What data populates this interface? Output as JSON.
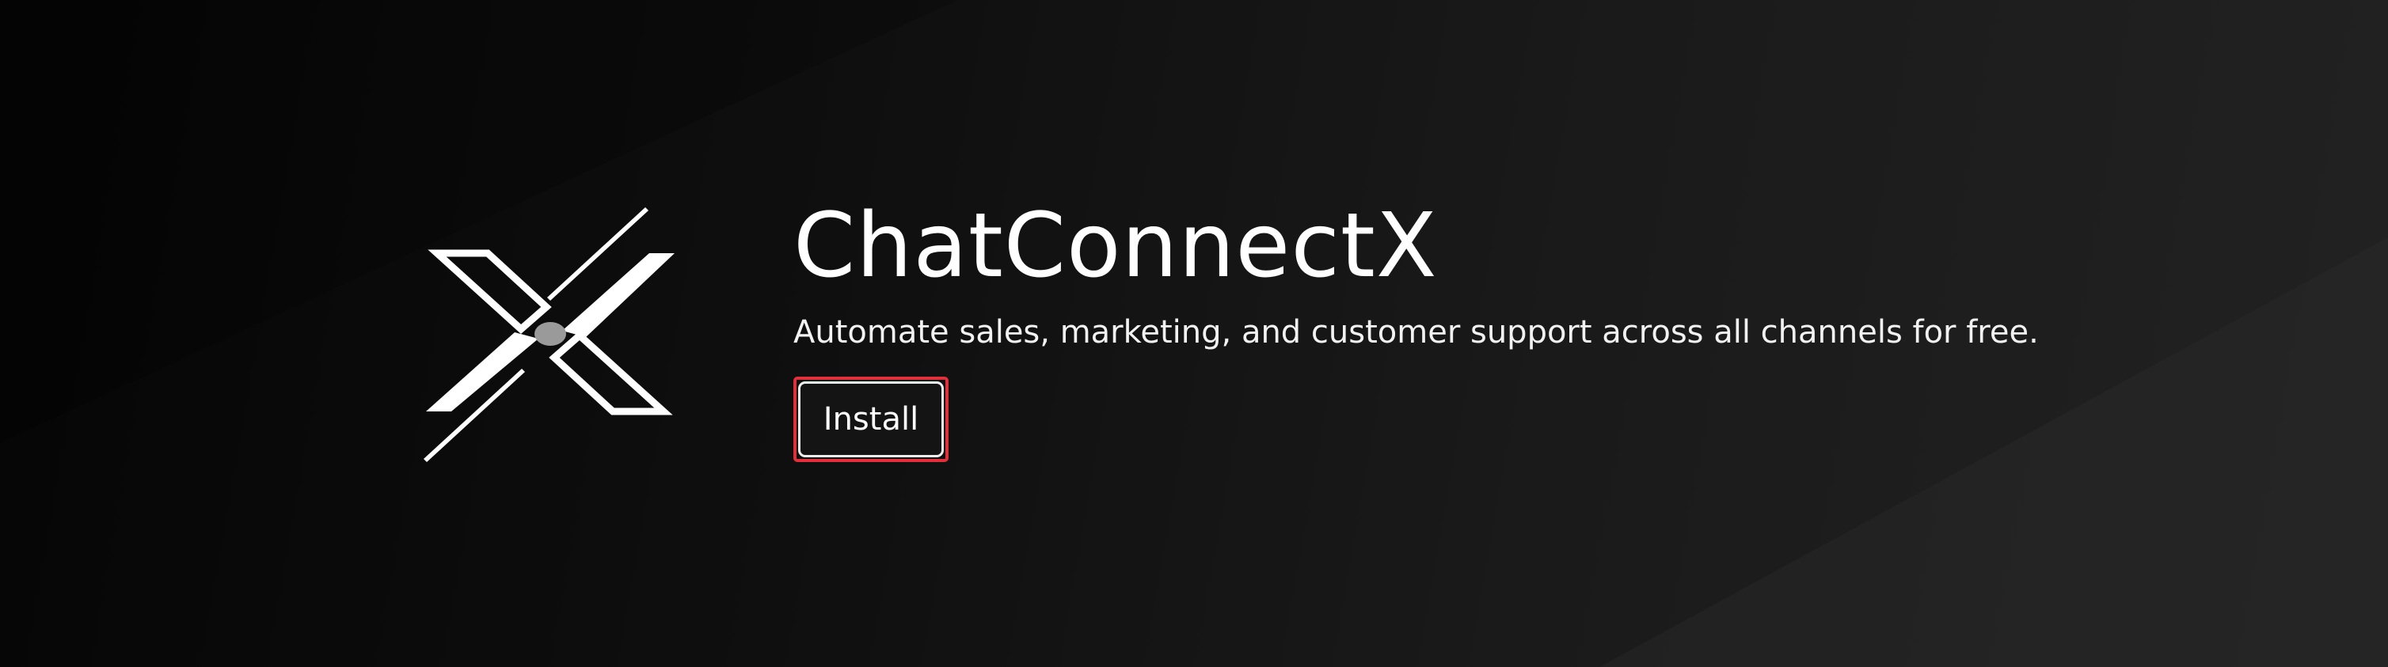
{
  "app": {
    "name": "ChatConnectX",
    "tagline": "Automate sales, marketing, and customer support across all channels for free."
  },
  "actions": {
    "install_label": "Install"
  },
  "icons": {
    "logo": "x-logo-icon"
  },
  "colors": {
    "background_dark": "#050505",
    "background_light": "#222222",
    "text": "#ffffff",
    "logo_dot": "#9a9a9a",
    "highlight": "#e0303a"
  }
}
